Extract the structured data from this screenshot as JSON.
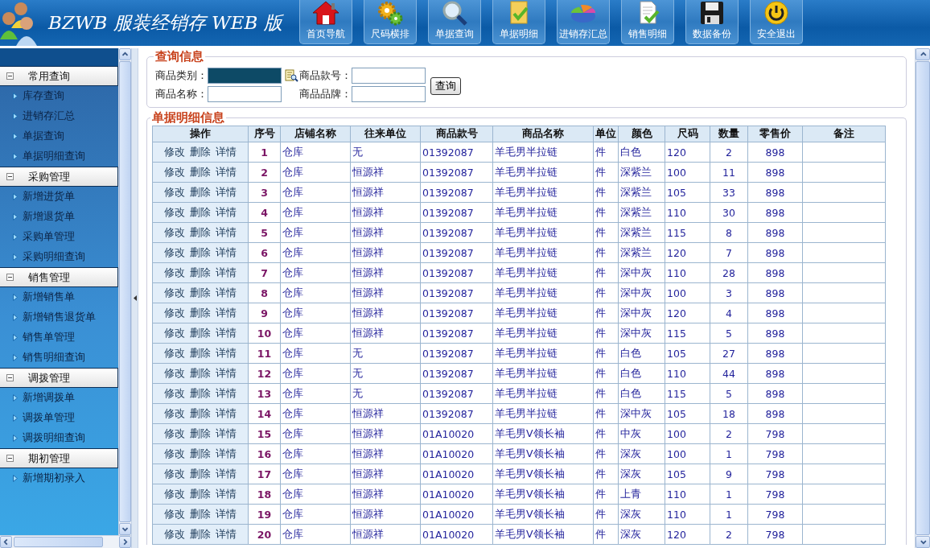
{
  "header": {
    "title": "BZWB 服装经销存 WEB 版",
    "nav_buttons": [
      {
        "label": "首页导航"
      },
      {
        "label": "尺码横排"
      },
      {
        "label": "单据查询"
      },
      {
        "label": "单据明细"
      },
      {
        "label": "进销存汇总"
      },
      {
        "label": "销售明细"
      },
      {
        "label": "数据备份"
      },
      {
        "label": "安全退出"
      }
    ]
  },
  "sidebar": {
    "sections": [
      {
        "title": "常用查询",
        "expanded": true,
        "items": [
          "库存查询",
          "进销存汇总",
          "单据查询",
          "单据明细查询"
        ]
      },
      {
        "title": "采购管理",
        "expanded": true,
        "items": [
          "新增进货单",
          "新增退货单",
          "采购单管理",
          "采购明细查询"
        ]
      },
      {
        "title": "销售管理",
        "expanded": true,
        "items": [
          "新增销售单",
          "新增销售退货单",
          "销售单管理",
          "销售明细查询"
        ]
      },
      {
        "title": "调拨管理",
        "expanded": true,
        "items": [
          "新增调拨单",
          "调拨单管理",
          "调拨明细查询"
        ]
      },
      {
        "title": "期初管理",
        "expanded": true,
        "items": [
          "新增期初录入"
        ]
      }
    ]
  },
  "query": {
    "title": "查询信息",
    "fields": [
      {
        "label": "商品类别：",
        "highlighted": true,
        "lookup": true
      },
      {
        "label": "商品款号：",
        "highlighted": false,
        "lookup": false
      },
      {
        "label": "商品名称：",
        "highlighted": false,
        "lookup": false
      },
      {
        "label": "商品品牌：",
        "highlighted": false,
        "lookup": false
      }
    ],
    "button": "查询"
  },
  "details": {
    "title": "单据明细信息",
    "columns": [
      "操作",
      "序号",
      "店铺名称",
      "往来单位",
      "商品款号",
      "商品名称",
      "单位",
      "颜色",
      "尺码",
      "数量",
      "零售价",
      "备注"
    ],
    "rows": [
      {
        "cells": [
          [
            "修改",
            "删除",
            "详情"
          ],
          "1",
          "仓库",
          "无",
          "01392087",
          "羊毛男半拉链",
          "件",
          "白色",
          "120",
          "2",
          "898"
        ]
      },
      {
        "cells": [
          [
            "修改",
            "删除",
            "详情"
          ],
          "2",
          "仓库",
          "恒源祥",
          "01392087",
          "羊毛男半拉链",
          "件",
          "深紫兰",
          "100",
          "11",
          "898"
        ]
      },
      {
        "cells": [
          [
            "修改",
            "删除",
            "详情"
          ],
          "3",
          "仓库",
          "恒源祥",
          "01392087",
          "羊毛男半拉链",
          "件",
          "深紫兰",
          "105",
          "33",
          "898"
        ]
      },
      {
        "cells": [
          [
            "修改",
            "删除",
            "详情"
          ],
          "4",
          "仓库",
          "恒源祥",
          "01392087",
          "羊毛男半拉链",
          "件",
          "深紫兰",
          "110",
          "30",
          "898"
        ]
      },
      {
        "cells": [
          [
            "修改",
            "删除",
            "详情"
          ],
          "5",
          "仓库",
          "恒源祥",
          "01392087",
          "羊毛男半拉链",
          "件",
          "深紫兰",
          "115",
          "8",
          "898"
        ]
      },
      {
        "cells": [
          [
            "修改",
            "删除",
            "详情"
          ],
          "6",
          "仓库",
          "恒源祥",
          "01392087",
          "羊毛男半拉链",
          "件",
          "深紫兰",
          "120",
          "7",
          "898"
        ]
      },
      {
        "cells": [
          [
            "修改",
            "删除",
            "详情"
          ],
          "7",
          "仓库",
          "恒源祥",
          "01392087",
          "羊毛男半拉链",
          "件",
          "深中灰",
          "110",
          "28",
          "898"
        ]
      },
      {
        "cells": [
          [
            "修改",
            "删除",
            "详情"
          ],
          "8",
          "仓库",
          "恒源祥",
          "01392087",
          "羊毛男半拉链",
          "件",
          "深中灰",
          "100",
          "3",
          "898"
        ]
      },
      {
        "cells": [
          [
            "修改",
            "删除",
            "详情"
          ],
          "9",
          "仓库",
          "恒源祥",
          "01392087",
          "羊毛男半拉链",
          "件",
          "深中灰",
          "120",
          "4",
          "898"
        ]
      },
      {
        "cells": [
          [
            "修改",
            "删除",
            "详情"
          ],
          "10",
          "仓库",
          "恒源祥",
          "01392087",
          "羊毛男半拉链",
          "件",
          "深中灰",
          "115",
          "5",
          "898"
        ]
      },
      {
        "cells": [
          [
            "修改",
            "删除",
            "详情"
          ],
          "11",
          "仓库",
          "无",
          "01392087",
          "羊毛男半拉链",
          "件",
          "白色",
          "105",
          "27",
          "898"
        ]
      },
      {
        "cells": [
          [
            "修改",
            "删除",
            "详情"
          ],
          "12",
          "仓库",
          "无",
          "01392087",
          "羊毛男半拉链",
          "件",
          "白色",
          "110",
          "44",
          "898"
        ]
      },
      {
        "cells": [
          [
            "修改",
            "删除",
            "详情"
          ],
          "13",
          "仓库",
          "无",
          "01392087",
          "羊毛男半拉链",
          "件",
          "白色",
          "115",
          "5",
          "898"
        ]
      },
      {
        "cells": [
          [
            "修改",
            "删除",
            "详情"
          ],
          "14",
          "仓库",
          "恒源祥",
          "01392087",
          "羊毛男半拉链",
          "件",
          "深中灰",
          "105",
          "18",
          "898"
        ]
      },
      {
        "cells": [
          [
            "修改",
            "删除",
            "详情"
          ],
          "15",
          "仓库",
          "恒源祥",
          "01A10020",
          "羊毛男V领长袖",
          "件",
          "中灰",
          "100",
          "2",
          "798"
        ]
      },
      {
        "cells": [
          [
            "修改",
            "删除",
            "详情"
          ],
          "16",
          "仓库",
          "恒源祥",
          "01A10020",
          "羊毛男V领长袖",
          "件",
          "深灰",
          "100",
          "1",
          "798"
        ]
      },
      {
        "cells": [
          [
            "修改",
            "删除",
            "详情"
          ],
          "17",
          "仓库",
          "恒源祥",
          "01A10020",
          "羊毛男V领长袖",
          "件",
          "深灰",
          "105",
          "9",
          "798"
        ]
      },
      {
        "cells": [
          [
            "修改",
            "删除",
            "详情"
          ],
          "18",
          "仓库",
          "恒源祥",
          "01A10020",
          "羊毛男V领长袖",
          "件",
          "上青",
          "110",
          "1",
          "798"
        ]
      },
      {
        "cells": [
          [
            "修改",
            "删除",
            "详情"
          ],
          "19",
          "仓库",
          "恒源祥",
          "01A10020",
          "羊毛男V领长袖",
          "件",
          "深灰",
          "110",
          "1",
          "798"
        ]
      },
      {
        "cells": [
          [
            "修改",
            "删除",
            "详情"
          ],
          "20",
          "仓库",
          "恒源祥",
          "01A10020",
          "羊毛男V领长袖",
          "件",
          "深灰",
          "120",
          "2",
          "798"
        ]
      }
    ]
  }
}
